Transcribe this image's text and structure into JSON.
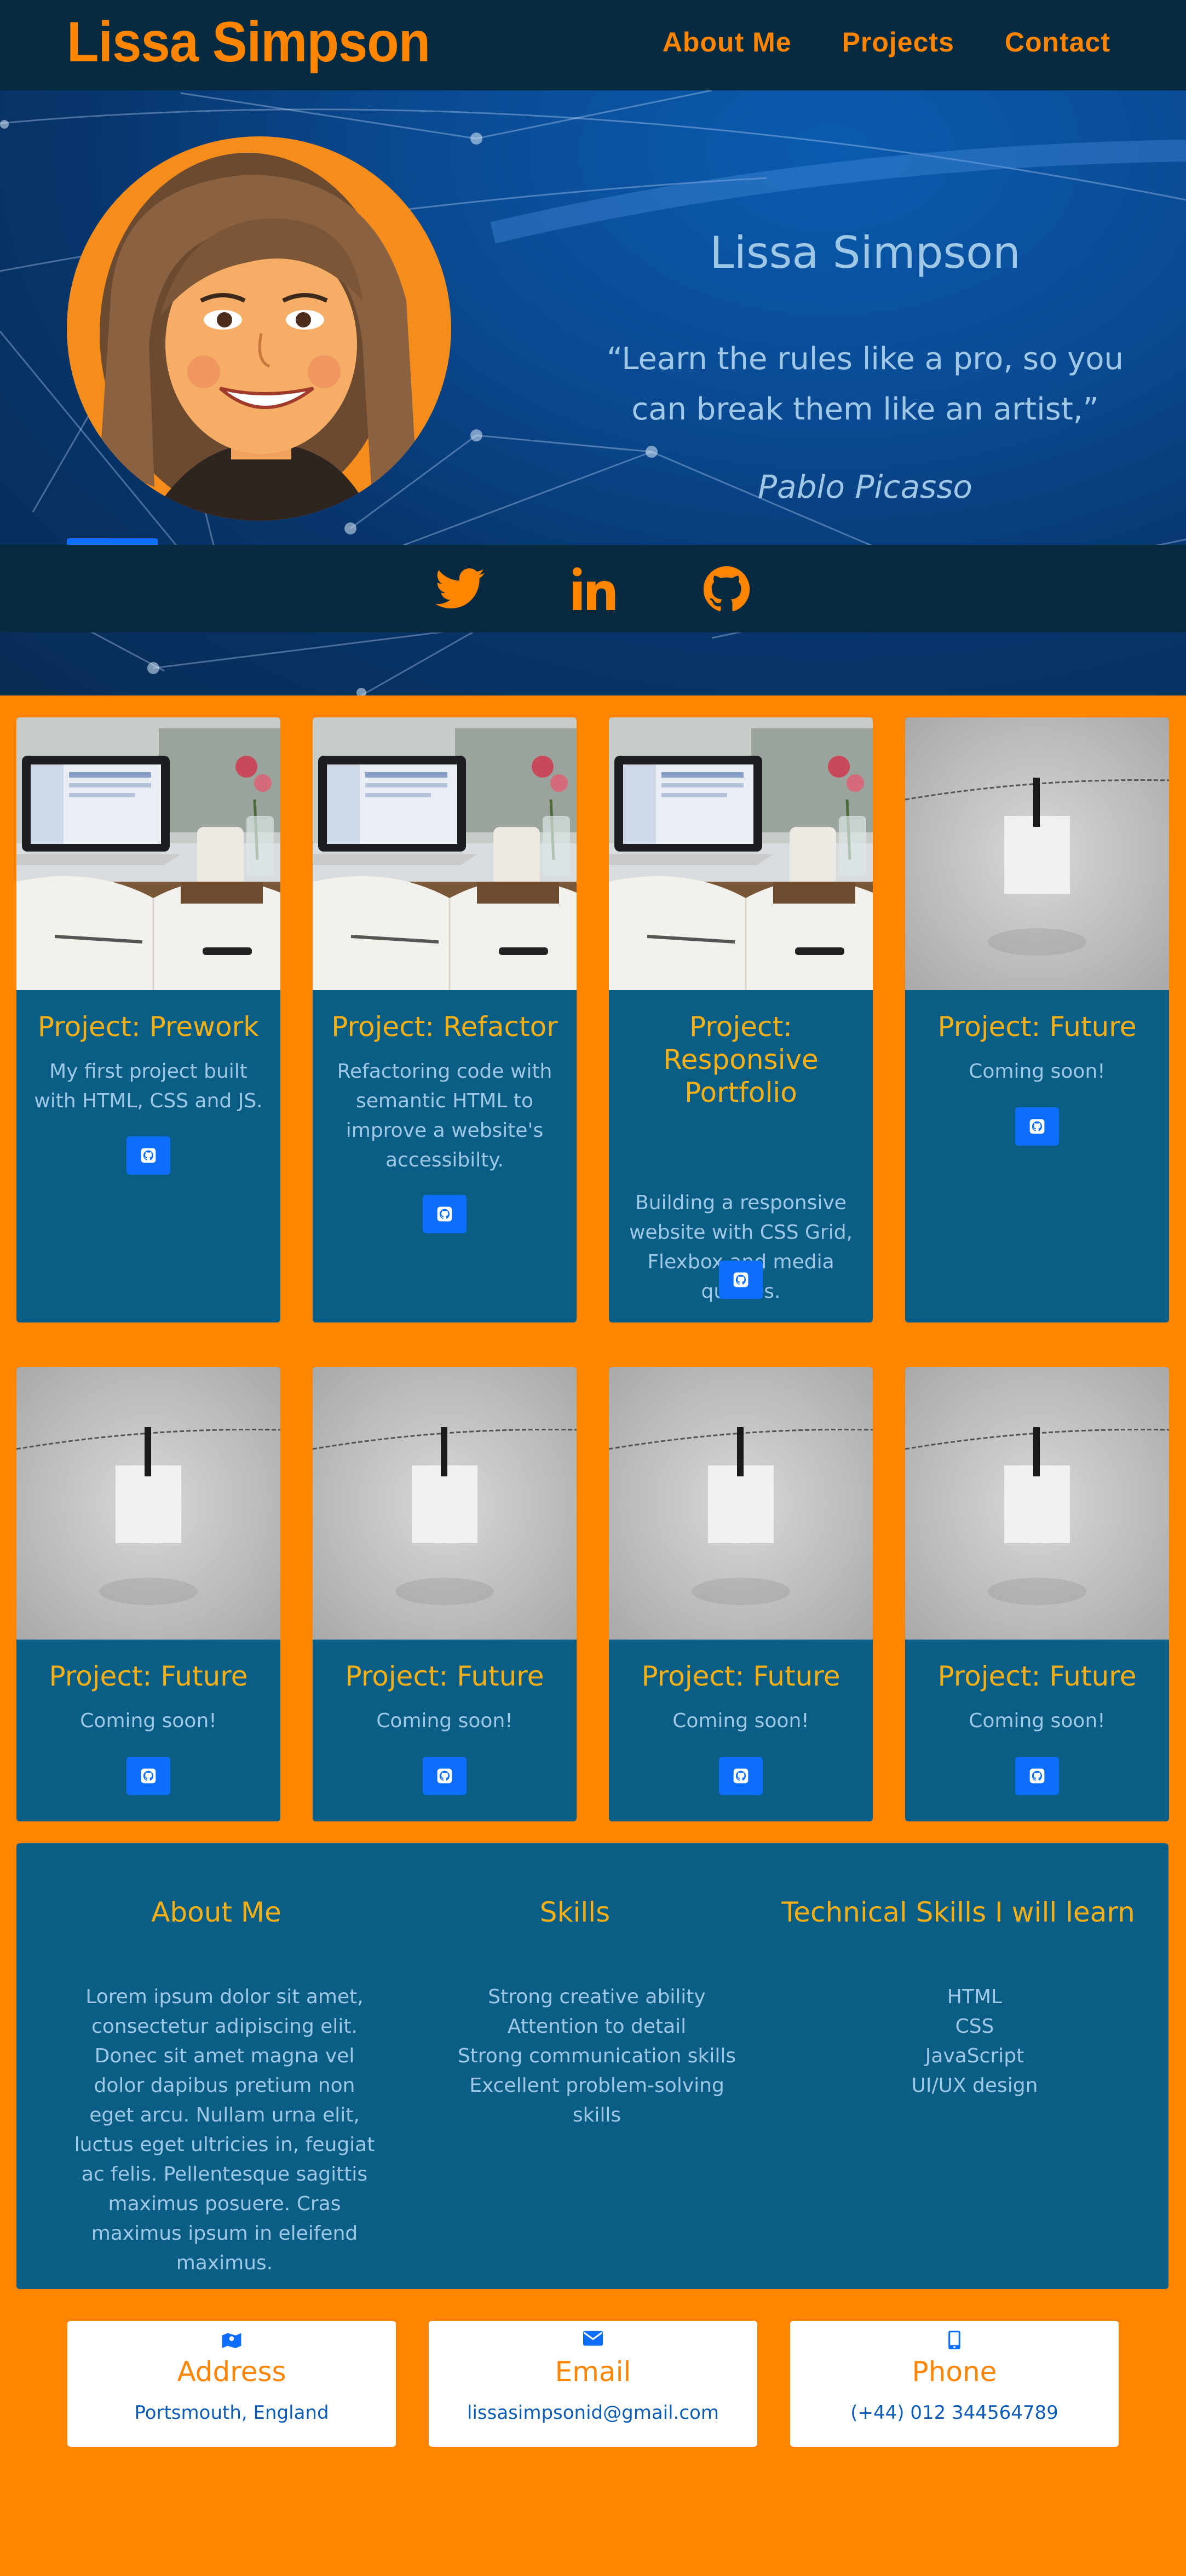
{
  "nav": {
    "brand": "Lissa Simpson",
    "links": [
      "About Me",
      "Projects",
      "Contact"
    ]
  },
  "hero": {
    "name": "Lissa Simpson",
    "quote": "“Learn the rules like a pro, so you can break them like an artist,”",
    "author": "Pablo Picasso"
  },
  "social": [
    "twitter-icon",
    "linkedin-icon",
    "github-icon"
  ],
  "projects": [
    {
      "title": "Project: Prework",
      "desc": "My first project built with HTML, CSS and JS."
    },
    {
      "title": "Project: Refactor",
      "desc": "Refactoring code with semantic HTML to improve a website's accessibilty."
    },
    {
      "title": "Project: Responsive Portfolio",
      "desc": "Building a responsive website with CSS Grid, Flexbox and media queries."
    },
    {
      "title": "Project: Future",
      "desc": "Coming soon!"
    },
    {
      "title": "Project: Future",
      "desc": "Coming soon!"
    },
    {
      "title": "Project: Future",
      "desc": "Coming soon!"
    },
    {
      "title": "Project: Future",
      "desc": "Coming soon!"
    },
    {
      "title": "Project: Future",
      "desc": "Coming soon!"
    }
  ],
  "about": {
    "about_heading": "About Me",
    "about_text": "Lorem ipsum dolor sit amet, consectetur adipiscing elit. Donec sit amet magna vel dolor dapibus pretium non eget arcu. Nullam urna elit, luctus eget ultricies in, feugiat ac felis. Pellentesque sagittis maximus posuere. Cras maximus ipsum in eleifend maximus.",
    "skills_heading": "Skills",
    "skills": [
      "Strong creative ability",
      "Attention to detail",
      "Strong communication skills",
      "Excellent problem-solving skills"
    ],
    "learn_heading": "Technical Skills I will learn",
    "learn": [
      "HTML",
      "CSS",
      "JavaScript",
      "UI/UX design"
    ]
  },
  "contact": {
    "address_label": "Address",
    "address_value": "Portsmouth, England",
    "email_label": "Email",
    "email_value": "lissasimpsonid@gmail.com",
    "phone_label": "Phone",
    "phone_value": "(+44) 012 344564789"
  },
  "colors": {
    "orange": "#ff8400",
    "navy": "#062a40",
    "card": "#0a5e85",
    "gold": "#f4b016",
    "blue_button": "#0d6efd"
  }
}
